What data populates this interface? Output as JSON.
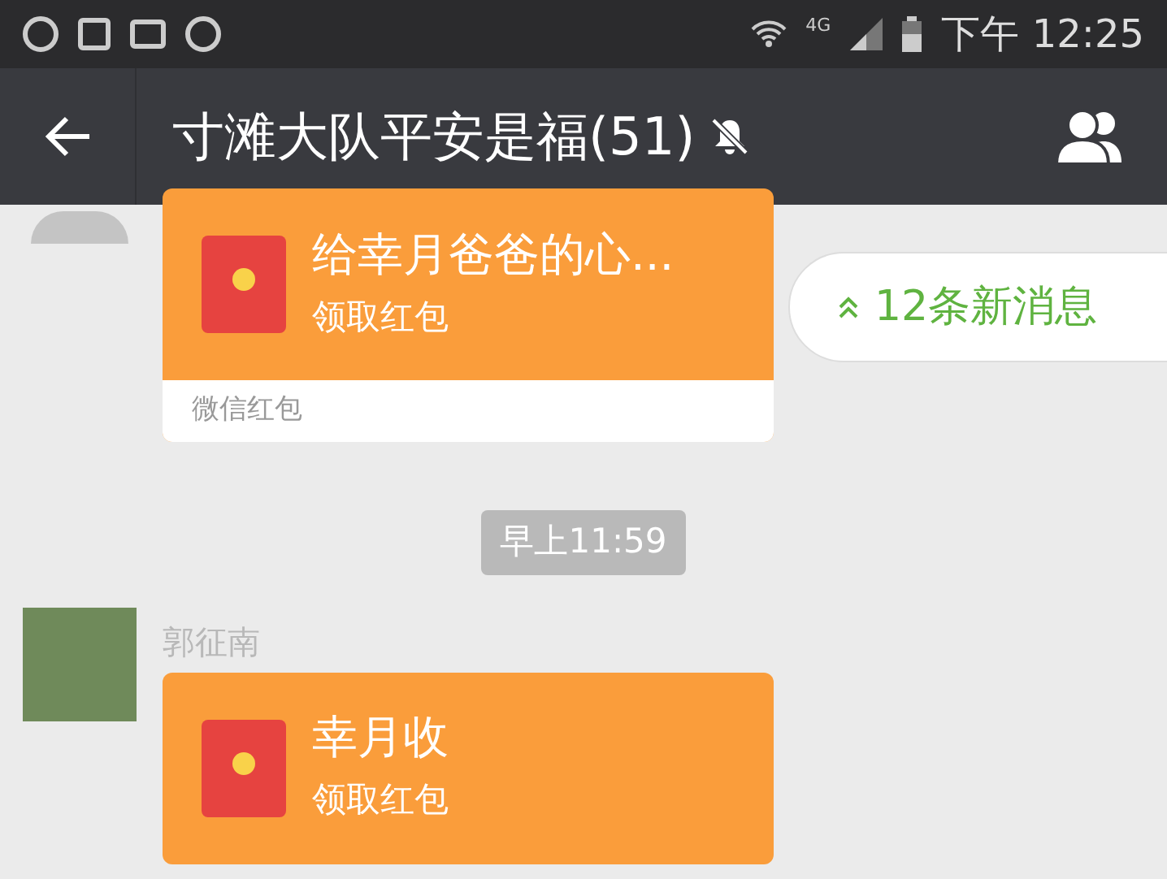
{
  "status_bar": {
    "time": "下午 12:25",
    "network": "4G"
  },
  "nav": {
    "title": "寸滩大队平安是福(51)",
    "muted": true
  },
  "new_messages": {
    "label": "12条新消息"
  },
  "messages": [
    {
      "kind": "red_packet",
      "greeting": "给幸月爸爸的心...",
      "action": "领取红包",
      "footer": "微信红包"
    },
    {
      "kind": "time",
      "label": "早上11:59"
    },
    {
      "kind": "red_packet",
      "sender": "郭征南",
      "greeting": "幸月收",
      "action": "领取红包"
    }
  ]
}
